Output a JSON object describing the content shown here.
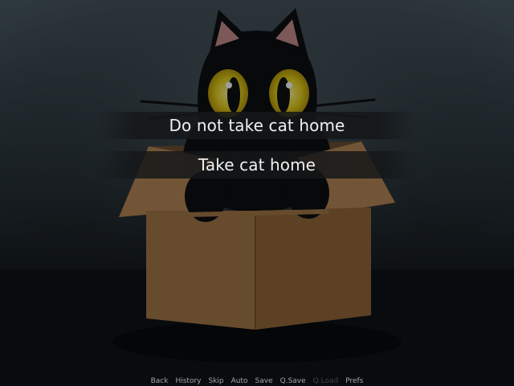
{
  "menu": {
    "choices": [
      {
        "label": "Do not take cat home"
      },
      {
        "label": "Take cat home"
      }
    ]
  },
  "quick_menu": {
    "items": [
      {
        "label": "Back",
        "enabled": true
      },
      {
        "label": "History",
        "enabled": true
      },
      {
        "label": "Skip",
        "enabled": true
      },
      {
        "label": "Auto",
        "enabled": true
      },
      {
        "label": "Save",
        "enabled": true
      },
      {
        "label": "Q.Save",
        "enabled": true
      },
      {
        "label": "Q.Load",
        "enabled": false
      },
      {
        "label": "Prefs",
        "enabled": true
      }
    ]
  },
  "colors": {
    "choice_text": "#f0f0f0",
    "quick_menu_text": "#a3a3a3",
    "quick_menu_disabled": "#3f4447",
    "cat_fur": "#0c0f11",
    "cat_eyes": "#e8d21c",
    "box": "#b88a57"
  }
}
